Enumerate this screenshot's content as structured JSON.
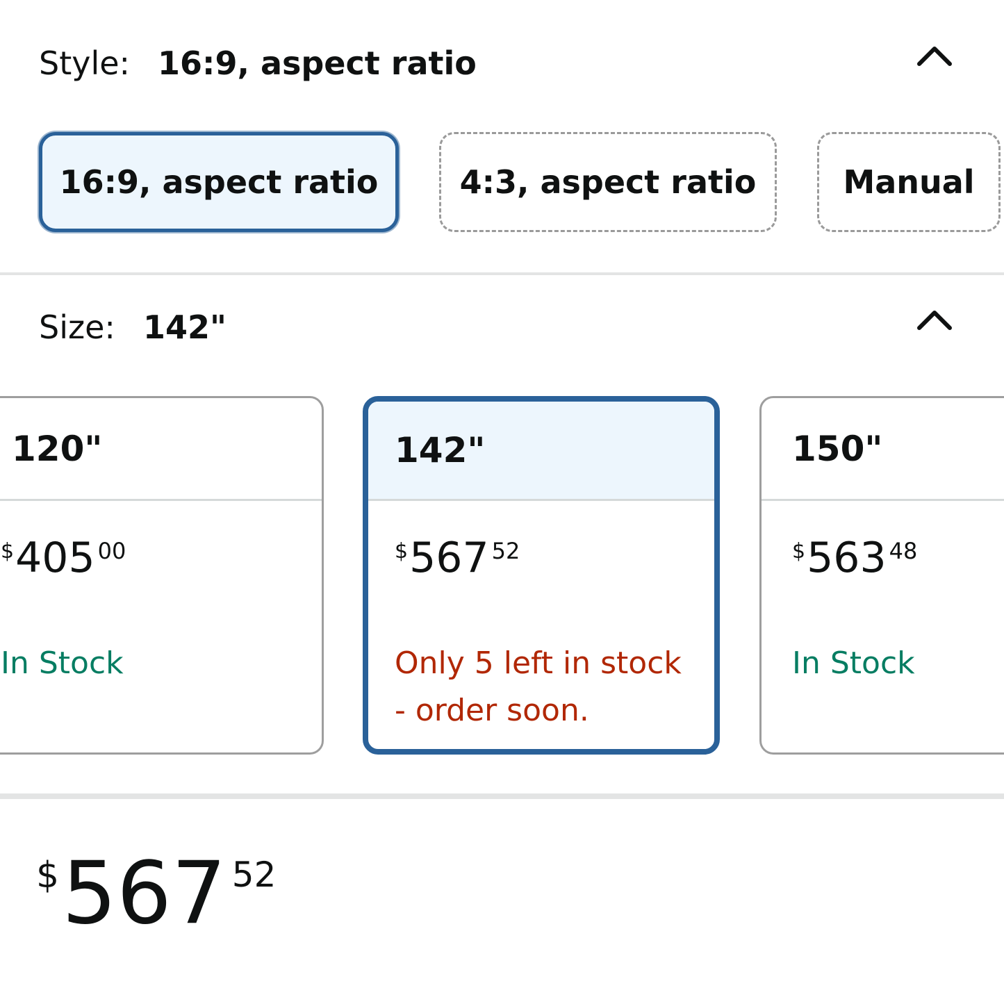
{
  "style": {
    "label": "Style:",
    "selected_value": "16:9, aspect ratio",
    "options": [
      {
        "label": "16:9, aspect ratio",
        "selected": true
      },
      {
        "label": "4:3, aspect ratio",
        "selected": false
      },
      {
        "label": "Manual",
        "selected": false
      }
    ],
    "collapse_icon": "chevron-up-icon"
  },
  "size": {
    "label": "Size:",
    "selected_value": "142\"",
    "collapse_icon": "chevron-up-icon",
    "options": [
      {
        "size": "120\"",
        "price_symbol": "$",
        "price_whole": "405",
        "price_fraction": "00",
        "stock": "In Stock",
        "stock_status": "in-stock",
        "selected": false
      },
      {
        "size": "142\"",
        "price_symbol": "$",
        "price_whole": "567",
        "price_fraction": "52",
        "stock": "Only 5 left in stock - order soon.",
        "stock_status": "low-stock",
        "selected": true
      },
      {
        "size": "150\"",
        "price_symbol": "$",
        "price_whole": "563",
        "price_fraction": "48",
        "stock": "In Stock",
        "stock_status": "in-stock",
        "selected": false
      }
    ]
  },
  "price": {
    "symbol": "$",
    "whole": "567",
    "fraction": "52"
  },
  "colors": {
    "selected_border": "#2a6199",
    "selected_background": "#edf6fd",
    "in_stock": "#067d62",
    "low_stock": "#b12704",
    "text": "#0f1111"
  }
}
